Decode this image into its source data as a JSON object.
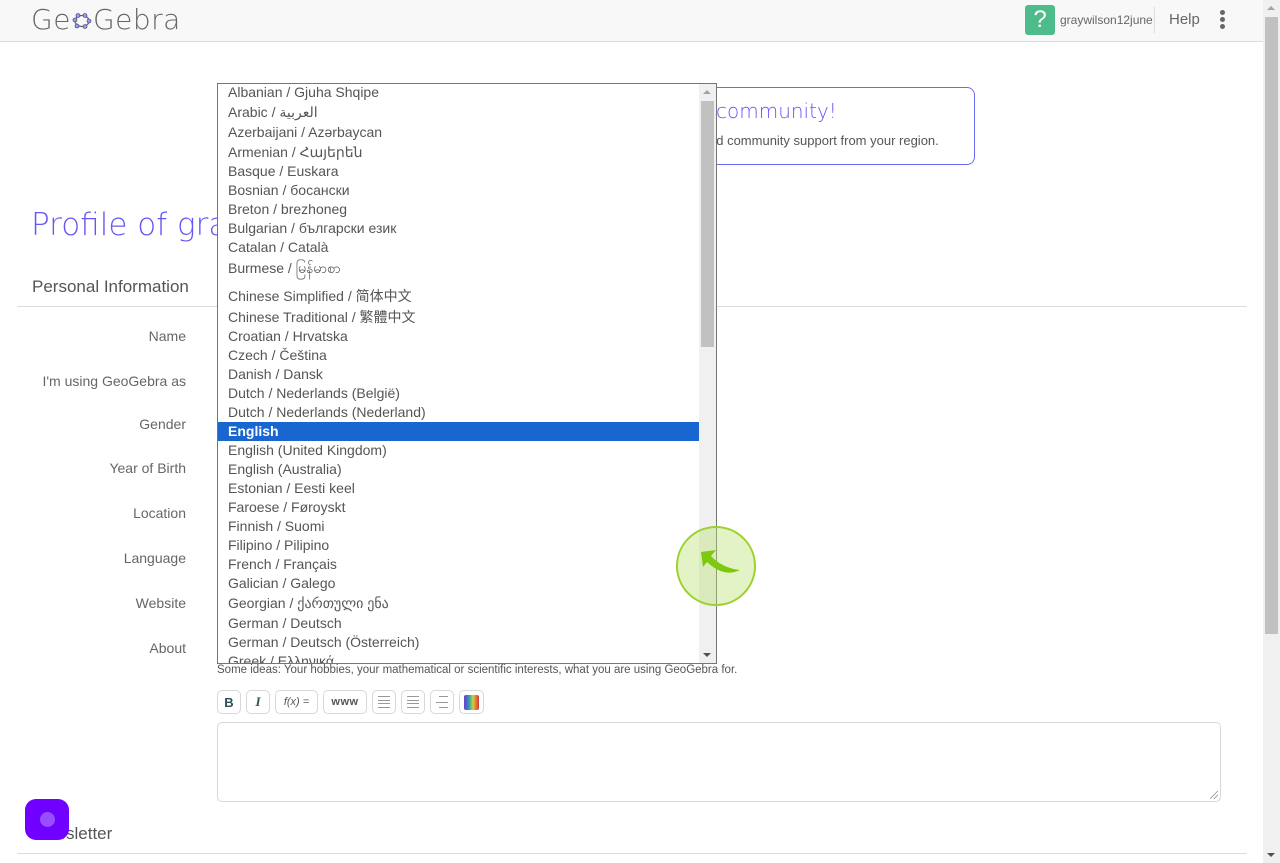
{
  "header": {
    "logo_text_left": "Ge",
    "logo_text_right": "Gebra",
    "user_badge_glyph": "?",
    "username": "graywilson12june",
    "help_label": "Help",
    "menu_icon": "kebab-menu-icon"
  },
  "banner": {
    "title": "community!",
    "text": "nd community support from your region."
  },
  "profile": {
    "title": "Profile of gra",
    "personal_section": "Personal Information",
    "fields": [
      "Name",
      "I'm using GeoGebra as",
      "Gender",
      "Year of Birth",
      "Location",
      "Language",
      "Website",
      "About"
    ],
    "about_hint": "Some ideas: Your hobbies, your mathematical or scientific interests, what you are using GeoGebra for.",
    "about_value": "",
    "newsletter_section": "Newsletter"
  },
  "editor_toolbar": {
    "bold": "B",
    "italic": "I",
    "formula": "f(x) =",
    "link": "www",
    "icons": [
      "bold-icon",
      "italic-icon",
      "formula-icon",
      "link-icon",
      "bullet-list-icon",
      "numbered-list-icon",
      "indent-list-icon",
      "color-icon"
    ]
  },
  "language_dropdown": {
    "selected": "English",
    "options": [
      "Albanian / Gjuha Shqipe",
      "Arabic / العربية",
      "Azerbaijani / Azərbaycan",
      "Armenian / Հայերեն",
      "Basque / Euskara",
      "Bosnian / босански",
      "Breton / brezhoneg",
      "Bulgarian / български език",
      "Catalan / Català",
      "Burmese / မြန်မာစာ",
      "Chinese Simplified / 简体中文",
      "Chinese Traditional / 繁體中文",
      "Croatian / Hrvatska",
      "Czech / Čeština",
      "Danish / Dansk",
      "Dutch / Nederlands (België)",
      "Dutch / Nederlands (Nederland)",
      "English",
      "English (United Kingdom)",
      "English (Australia)",
      "Estonian / Eesti keel",
      "Faroese / Føroyskt",
      "Finnish / Suomi",
      "Filipino / Pilipino",
      "French / Français",
      "Galician / Galego",
      "Georgian / ქართული ენა",
      "German / Deutsch",
      "German / Deutsch (Österreich)",
      "Greek / Ελληνικά"
    ]
  },
  "colors": {
    "accent": "#6557f5",
    "selection": "#1a66d1",
    "user_badge": "#4dbb8a",
    "chat_button": "#7000ff"
  }
}
